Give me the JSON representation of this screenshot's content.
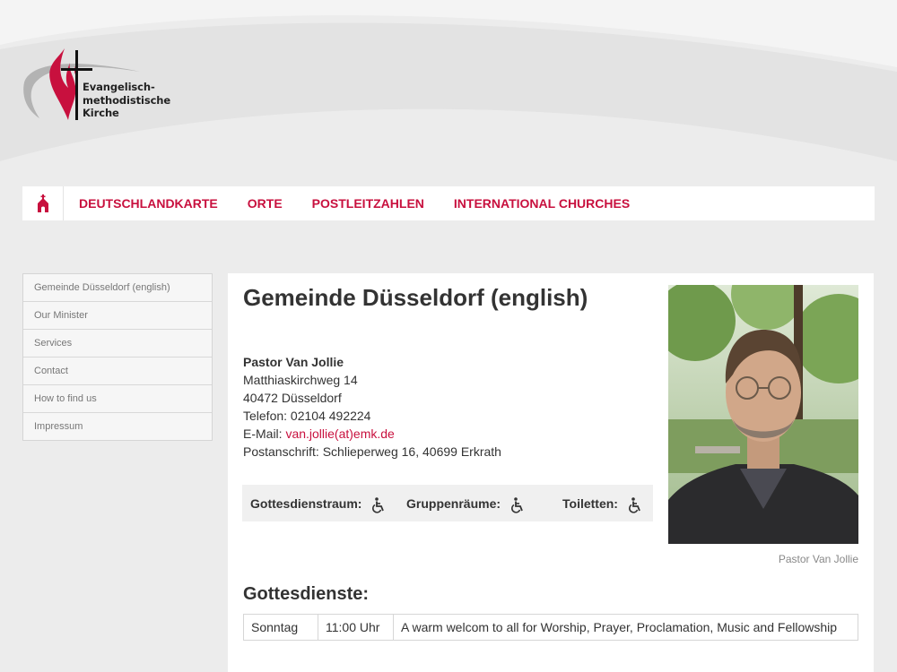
{
  "logo": {
    "lines": [
      "Evangelisch-",
      "methodistische",
      "Kirche"
    ]
  },
  "nav": {
    "home_icon": "church-icon",
    "items": [
      "DEUTSCHLANDKARTE",
      "ORTE",
      "POSTLEITZAHLEN",
      "INTERNATIONAL CHURCHES"
    ]
  },
  "sidebar": {
    "items": [
      {
        "label": "Gemeinde Düsseldorf (english)"
      },
      {
        "label": "Our Minister"
      },
      {
        "label": "Services"
      },
      {
        "label": "Contact"
      },
      {
        "label": "How to find us"
      },
      {
        "label": "Impressum"
      }
    ]
  },
  "main": {
    "title": "Gemeinde Düsseldorf (english)",
    "contact": {
      "pastor": "Pastor Van Jollie",
      "street": "Matthiaskirchweg 14",
      "city": "40472 Düsseldorf",
      "phone": "Telefon: 02104 492224",
      "email_prefix": "E-Mail: ",
      "email": "van.jollie(at)emk.de",
      "postal": "Postanschrift: Schlieperweg 16, 40699 Erkrath"
    },
    "accessibility": [
      {
        "label": "Gottesdienstraum:",
        "icon": "wheelchair-icon"
      },
      {
        "label": "Gruppenräume:",
        "icon": "wheelchair-icon"
      },
      {
        "label": "Toiletten:",
        "icon": "wheelchair-icon"
      }
    ],
    "photo_caption": "Pastor Van Jollie",
    "services_title": "Gottesdienste:",
    "services": [
      {
        "day": "Sonntag",
        "time": "11:00 Uhr",
        "description": "A warm welcom to all for Worship, Prayer, Proclamation, Music and Fellowship"
      }
    ]
  },
  "colors": {
    "accent": "#c8103e",
    "background": "#ececec"
  }
}
